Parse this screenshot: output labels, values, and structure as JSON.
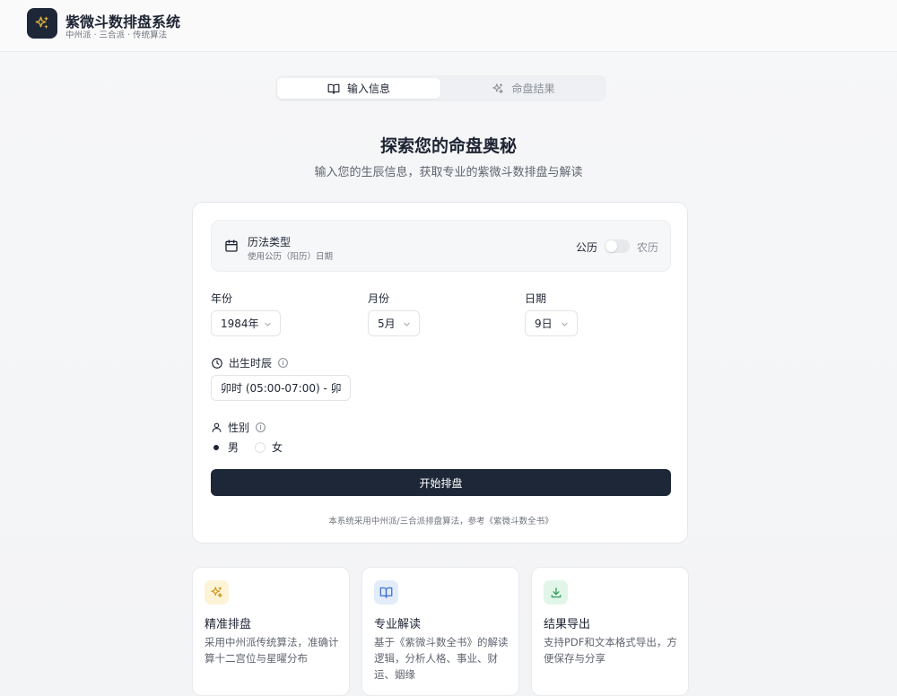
{
  "app": {
    "title": "紫微斗数排盘系统",
    "subtitle": "中州派 · 三合派 · 传统算法",
    "logo_icon": "sparkles-icon"
  },
  "tabs": [
    {
      "label": "输入信息",
      "icon": "book-open-icon",
      "active": true
    },
    {
      "label": "命盘结果",
      "icon": "sparkles-icon",
      "active": false
    }
  ],
  "hero": {
    "title": "探索您的命盘奥秘",
    "subtitle": "输入您的生辰信息，获取专业的紫微斗数排盘与解读"
  },
  "calendar": {
    "title": "历法类型",
    "desc": "使用公历（阳历）日期",
    "option_solar": "公历",
    "option_lunar": "农历",
    "lunar_enabled": false
  },
  "date": {
    "year_label": "年份",
    "year_value": "1984年",
    "month_label": "月份",
    "month_value": "5月",
    "day_label": "日期",
    "day_value": "9日"
  },
  "time": {
    "label": "出生时辰",
    "value": "卯时 (05:00-07:00) - 卯"
  },
  "gender": {
    "label": "性别",
    "male": "男",
    "female": "女",
    "selected": "男"
  },
  "submit_label": "开始排盘",
  "footnote": "本系统采用中州派/三合派排盘算法，参考《紫微斗数全书》",
  "features": [
    {
      "title": "精准排盘",
      "desc": "采用中州派传统算法，准确计算十二宫位与星曜分布",
      "icon": "sparkles-icon",
      "bg": "#fdf3d6",
      "fg": "#c9971c"
    },
    {
      "title": "专业解读",
      "desc": "基于《紫微斗数全书》的解读逻辑，分析人格、事业、财运、姻缘",
      "icon": "book-open-icon",
      "bg": "#e3ecfb",
      "fg": "#3b6fd4"
    },
    {
      "title": "结果导出",
      "desc": "支持PDF和文本格式导出，方便保存与分享",
      "icon": "download-icon",
      "bg": "#e1f5e8",
      "fg": "#2f9e5a"
    }
  ],
  "colors": {
    "primary": "#1e2738",
    "accent_gold": "#e0b43a"
  }
}
